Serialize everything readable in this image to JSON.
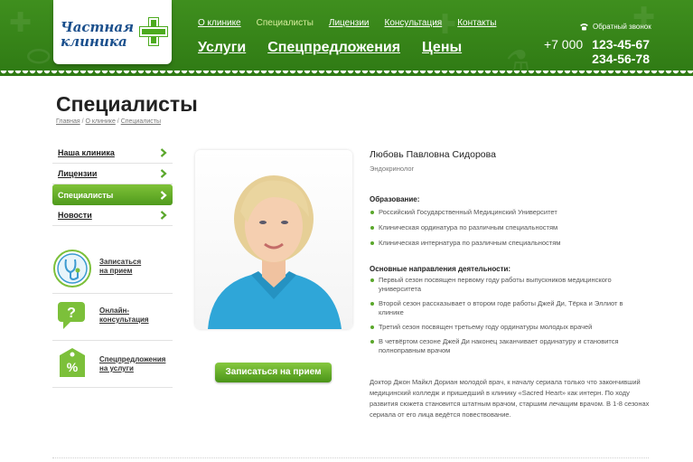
{
  "logo": {
    "line1": "Частная",
    "line2": "клиника"
  },
  "top_menu": [
    {
      "label": "О клинике",
      "active": false
    },
    {
      "label": "Специалисты",
      "active": true
    },
    {
      "label": "Лицензии",
      "active": false
    },
    {
      "label": "Консультация",
      "active": false
    },
    {
      "label": "Контакты",
      "active": false
    }
  ],
  "main_menu": [
    "Услуги",
    "Спецпредложения",
    "Цены"
  ],
  "header": {
    "callback_label": "Обратный звонок",
    "phone_code": "+7 000",
    "phone1": "123-45-67",
    "phone2": "234-56-78"
  },
  "page": {
    "title": "Специалисты",
    "breadcrumb": [
      "Главная",
      "О клинике",
      "Специалисты"
    ]
  },
  "sidebar": {
    "items": [
      {
        "label": "Наша клиника",
        "active": false
      },
      {
        "label": "Лицензии",
        "active": false
      },
      {
        "label": "Специалисты",
        "active": true
      },
      {
        "label": "Новости",
        "active": false
      }
    ],
    "promos": [
      {
        "line1": "Записаться",
        "line2": "на прием",
        "icon": "stethoscope-icon"
      },
      {
        "line1": "Онлайн-",
        "line2": "консультация",
        "icon": "chat-bubble-icon"
      },
      {
        "line1": "Спецпредложения",
        "line2": "на услуги",
        "icon": "discount-tag-icon"
      }
    ]
  },
  "doctor": {
    "name": "Любовь Павловна Сидорова",
    "role": "Эндокринолог",
    "signup_label": "Записаться на прием",
    "education_title": "Образование:",
    "education": [
      "Российский Государственный Медицинский Университет",
      "Клиническая ординатура по различным специальностям",
      "Клиническая интернатура по различным специальностям"
    ],
    "activity_title": "Основные направления деятельности:",
    "activity": [
      "Первый сезон посвящен первому году работы выпускников медицинского университета",
      "Второй сезон рассказывает о втором годе работы Джей Ди, Тёрка и Эллиот в клинике",
      "Третий сезон посвящен третьему году ординатуры молодых врачей",
      "В четвёртом сезоне Джей Ди наконец заканчивает ординатуру и становится полноправным врачом"
    ],
    "bio": "Доктор Джон Майкл Дориан молодой врач, к началу сериала только что закончивший медицинский колледж и пришедший в клинику «Sacred Heart» как интерн. По ходу развития сюжета становится штатным врачом, старшим лечащим врачом. В 1-8 сезонах сериала от его лица ведётся повествование."
  },
  "colors": {
    "brand_green": "#3f8f1e",
    "accent_light": "#d8ef9e",
    "logo_blue": "#1a4f8c"
  }
}
